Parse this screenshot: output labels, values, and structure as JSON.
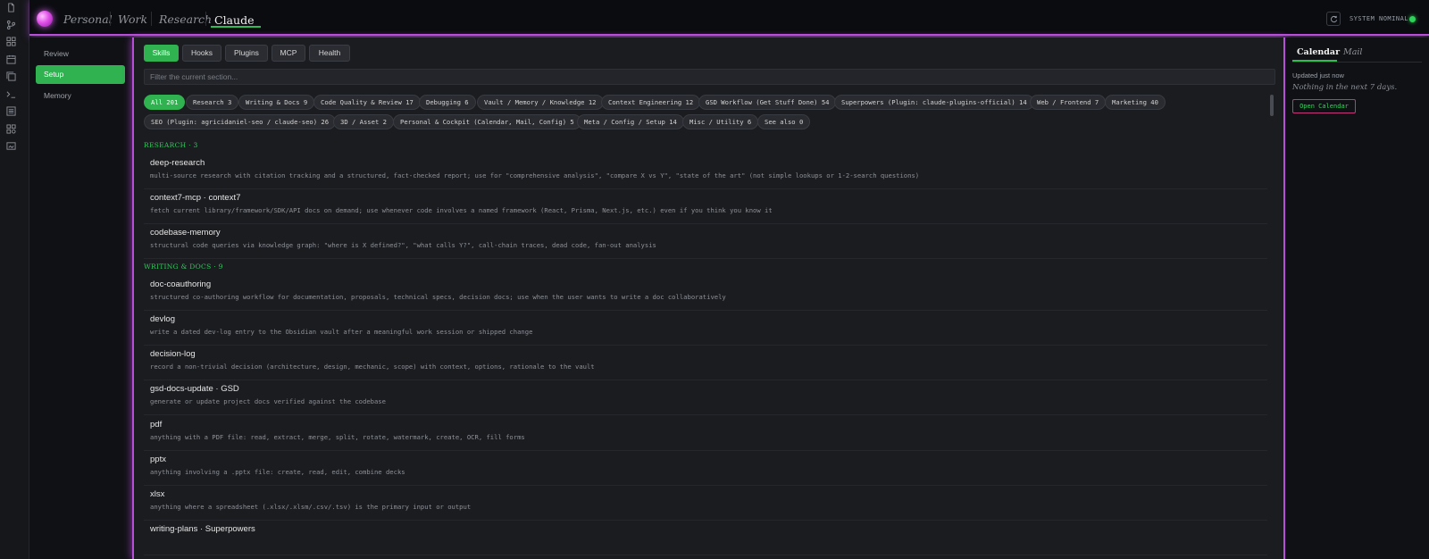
{
  "nav": {
    "tabs": [
      {
        "label": "Personal"
      },
      {
        "label": "Work"
      },
      {
        "label": "Research"
      },
      {
        "label": "Claude"
      }
    ],
    "status_text": "SYSTEM NOMINAL",
    "accent_color": "#b84fd8",
    "status_color": "#2ed15a"
  },
  "rail_icons": [
    "document-icon",
    "branch-icon",
    "grid-icon",
    "calendar-icon",
    "copy-icon",
    "terminal-icon",
    "list-icon",
    "apps-icon",
    "image-icon"
  ],
  "sidenav": {
    "items": [
      {
        "label": "Review"
      },
      {
        "label": "Setup"
      },
      {
        "label": "Memory"
      }
    ]
  },
  "main": {
    "tabs": [
      {
        "label": "Skills"
      },
      {
        "label": "Hooks"
      },
      {
        "label": "Plugins"
      },
      {
        "label": "MCP"
      },
      {
        "label": "Health"
      }
    ],
    "filter_placeholder": "Filter the current section...",
    "chips": [
      {
        "label": "All 201"
      },
      {
        "label": "Research 3"
      },
      {
        "label": "Writing & Docs 9"
      },
      {
        "label": "Code Quality & Review 17"
      },
      {
        "label": "Debugging 6"
      },
      {
        "label": "Vault / Memory / Knowledge 12"
      },
      {
        "label": "Context Engineering 12"
      },
      {
        "label": "GSD Workflow (Get Stuff Done) 54"
      },
      {
        "label": "Superpowers (Plugin: claude-plugins-official) 14"
      },
      {
        "label": "Web / Frontend 7"
      },
      {
        "label": "Marketing 40"
      },
      {
        "label": "SEO (Plugin: agricidaniel-seo / claude-seo) 26"
      },
      {
        "label": "3D / Asset 2"
      },
      {
        "label": "Personal & Cockpit (Calendar, Mail, Config) 5"
      },
      {
        "label": "Meta / Config / Setup 14"
      },
      {
        "label": "Misc / Utility 6"
      },
      {
        "label": "See also 0"
      }
    ],
    "sections": [
      {
        "title": "RESEARCH · 3",
        "entries": [
          {
            "name": "deep-research",
            "desc": "multi-source research with citation tracking and a structured, fact-checked report; use for \"comprehensive analysis\", \"compare X vs Y\", \"state of the art\" (not simple lookups or 1-2-search questions)"
          },
          {
            "name": "context7-mcp · context7",
            "desc": "fetch current library/framework/SDK/API docs on demand; use whenever code involves a named framework (React, Prisma, Next.js, etc.) even if you think you know it"
          },
          {
            "name": "codebase-memory",
            "desc": "structural code queries via knowledge graph: \"where is X defined?\", \"what calls Y?\", call-chain traces, dead code, fan-out analysis"
          }
        ]
      },
      {
        "title": "WRITING & DOCS · 9",
        "entries": [
          {
            "name": "doc-coauthoring",
            "desc": "structured co-authoring workflow for documentation, proposals, technical specs, decision docs; use when the user wants to write a doc collaboratively"
          },
          {
            "name": "devlog",
            "desc": "write a dated dev-log entry to the Obsidian vault after a meaningful work session or shipped change"
          },
          {
            "name": "decision-log",
            "desc": "record a non-trivial decision (architecture, design, mechanic, scope) with context, options, rationale to the vault"
          },
          {
            "name": "gsd-docs-update · GSD",
            "desc": "generate or update project docs verified against the codebase"
          },
          {
            "name": "pdf",
            "desc": "anything with a PDF file: read, extract, merge, split, rotate, watermark, create, OCR, fill forms"
          },
          {
            "name": "pptx",
            "desc": "anything involving a .pptx file: create, read, edit, combine decks"
          },
          {
            "name": "xlsx",
            "desc": "anything where a spreadsheet (.xlsx/.xlsm/.csv/.tsv) is the primary input or output"
          },
          {
            "name": "writing-plans · Superpowers",
            "desc": ""
          }
        ]
      }
    ]
  },
  "right_panel": {
    "tabs": [
      {
        "label": "Calendar"
      },
      {
        "label": "Mail"
      }
    ],
    "updated": "Updated just now",
    "empty_text": "Nothing in the next 7 days.",
    "button": "Open Calendar"
  }
}
